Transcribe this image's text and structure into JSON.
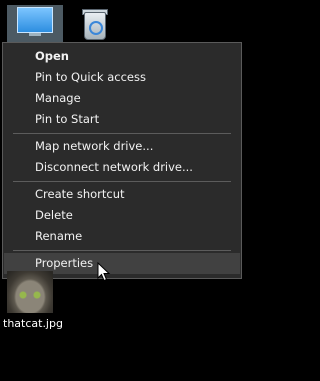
{
  "desktop": {
    "icons": [
      {
        "name": "this-pc",
        "label": ""
      },
      {
        "name": "recycle-bin",
        "label": ""
      },
      {
        "name": "cat-image",
        "label": "thatcat.jpg"
      }
    ]
  },
  "context_menu": {
    "groups": [
      [
        "Open",
        "Pin to Quick access",
        "Manage",
        "Pin to Start"
      ],
      [
        "Map network drive...",
        "Disconnect network drive..."
      ],
      [
        "Create shortcut",
        "Delete",
        "Rename"
      ],
      [
        "Properties"
      ]
    ],
    "default_item": "Open",
    "hovered_item": "Properties"
  },
  "colors": {
    "desktop_bg": "#000000",
    "menu_bg": "#2b2b2b",
    "menu_border": "#5a5a5a",
    "menu_text": "#f2f2f2",
    "hover_bg": "#414141",
    "separator": "#5c5c5c"
  }
}
